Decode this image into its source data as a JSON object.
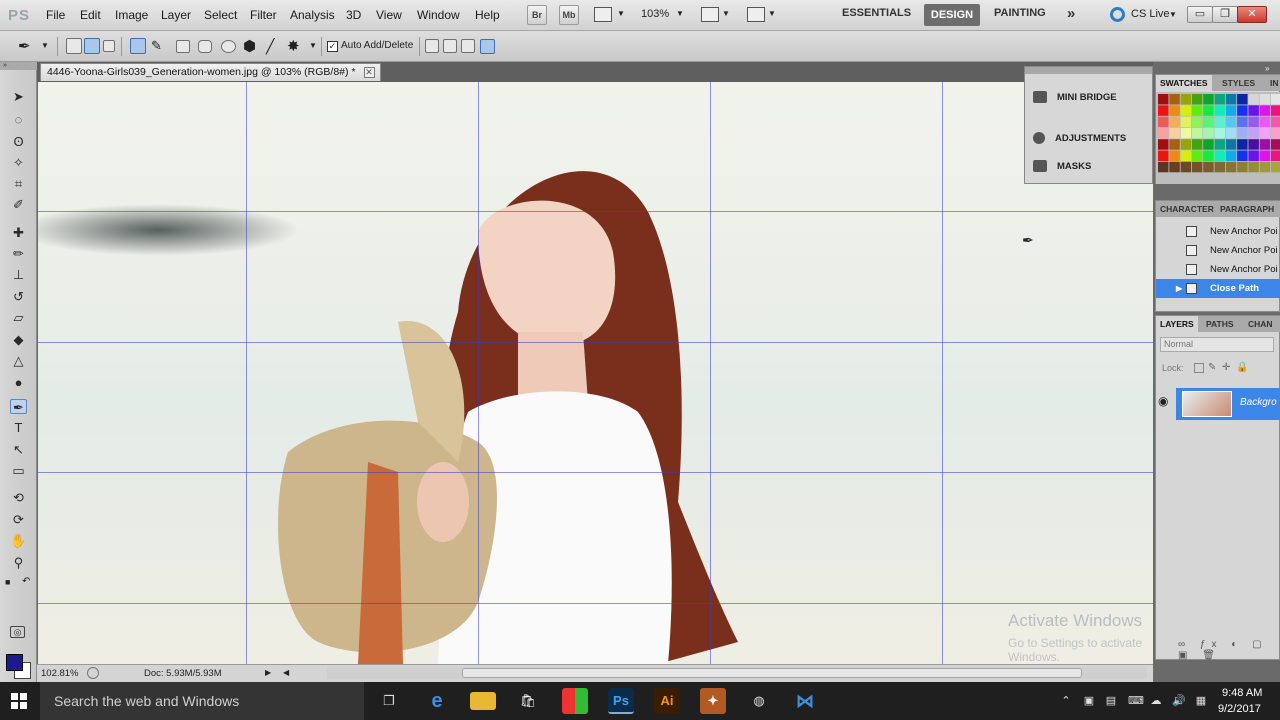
{
  "app": {
    "logo": "PS"
  },
  "menu": [
    "File",
    "Edit",
    "Image",
    "Layer",
    "Select",
    "Filter",
    "Analysis",
    "3D",
    "View",
    "Window",
    "Help"
  ],
  "menubar_buttons": {
    "bridge": "Br",
    "mini_bridge": "Mb",
    "zoom": "103%"
  },
  "workspaces": {
    "essentials": "ESSENTIALS",
    "design": "DESIGN",
    "painting": "PAINTING",
    "more": "»",
    "cs_live": "CS Live"
  },
  "window_controls": {
    "minimize": "▭",
    "restore": "❐",
    "close": "✕"
  },
  "options_bar": {
    "auto_add_delete": "Auto Add/Delete",
    "auto_add_delete_checked": true
  },
  "document": {
    "tab_title": "4446-Yoona-Girls039_Generation-women.jpg @ 103% (RGB/8#) *",
    "close": "✕"
  },
  "status": {
    "zoom": "102.81%",
    "doc_size": "Doc: 5.93M/5.93M",
    "arrow_right": "▶",
    "arrow_left": "◀"
  },
  "collapsed_panels": [
    {
      "label": "MINI BRIDGE",
      "icon": "mini-bridge-icon"
    },
    {
      "label": "ADJUSTMENTS",
      "icon": "adjustments-icon"
    },
    {
      "label": "MASKS",
      "icon": "masks-icon"
    }
  ],
  "swatches_panel": {
    "tabs": [
      "SWATCHES",
      "STYLES",
      "IN"
    ]
  },
  "history_panel": {
    "tabs": [
      "CHARACTER",
      "PARAGRAPH"
    ],
    "items": [
      {
        "label": "New Anchor Poi",
        "active": false
      },
      {
        "label": "New Anchor Poi",
        "active": false
      },
      {
        "label": "New Anchor Poi",
        "active": false
      },
      {
        "label": "Close Path",
        "active": true
      }
    ]
  },
  "layers_panel": {
    "tabs": [
      "LAYERS",
      "PATHS",
      "CHAN"
    ],
    "blend_mode": "Normal",
    "lock_label": "Lock:",
    "layer_name": "Backgro"
  },
  "watermark": {
    "title": "Activate Windows",
    "subtitle": "Go to Settings to activate Windows."
  },
  "taskbar": {
    "search_placeholder": "Search the web and Windows",
    "time": "9:48 AM",
    "date": "9/2/2017"
  },
  "colors": {
    "foreground": "#1b1a8f",
    "background": "#ffffff",
    "selection": "#3b86e6",
    "guides": "#3c3cc8"
  }
}
